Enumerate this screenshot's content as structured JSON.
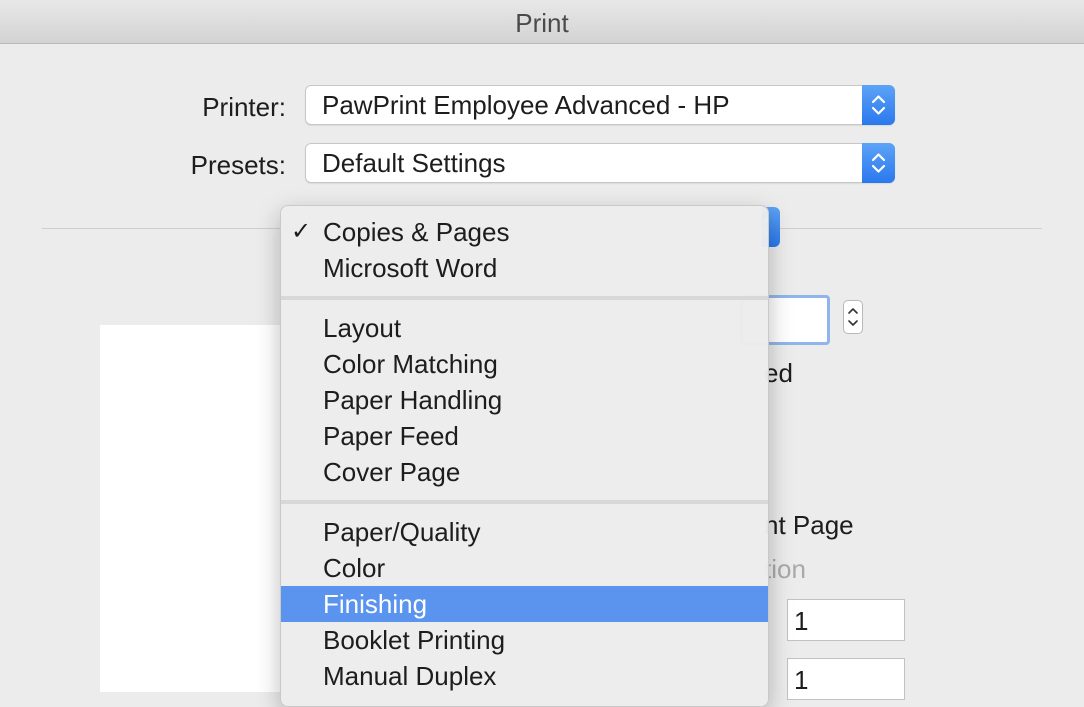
{
  "window": {
    "title": "Print"
  },
  "printer": {
    "label": "Printer:",
    "value": "PawPrint Employee Advanced - HP"
  },
  "presets": {
    "label": "Presets:",
    "value": "Default Settings"
  },
  "background": {
    "partial_ed": "ed",
    "partial_current_page": "nt Page",
    "partial_selection": "tion",
    "from_value": "1",
    "to_value": "1"
  },
  "menu": {
    "groups": [
      {
        "items": [
          {
            "label": "Copies & Pages",
            "checked": true
          },
          {
            "label": "Microsoft Word"
          }
        ]
      },
      {
        "items": [
          {
            "label": "Layout"
          },
          {
            "label": "Color Matching"
          },
          {
            "label": "Paper Handling"
          },
          {
            "label": "Paper Feed"
          },
          {
            "label": "Cover Page"
          }
        ]
      },
      {
        "items": [
          {
            "label": "Paper/Quality"
          },
          {
            "label": "Color"
          },
          {
            "label": "Finishing",
            "highlighted": true
          },
          {
            "label": "Booklet Printing"
          },
          {
            "label": "Manual Duplex"
          }
        ]
      }
    ],
    "check_glyph": "✓",
    "highlight_color": "#5b94ee"
  },
  "icons": {
    "popup_stepper": "up-down-chevron-icon",
    "copies_stepper": "up-down-stepper-icon"
  }
}
